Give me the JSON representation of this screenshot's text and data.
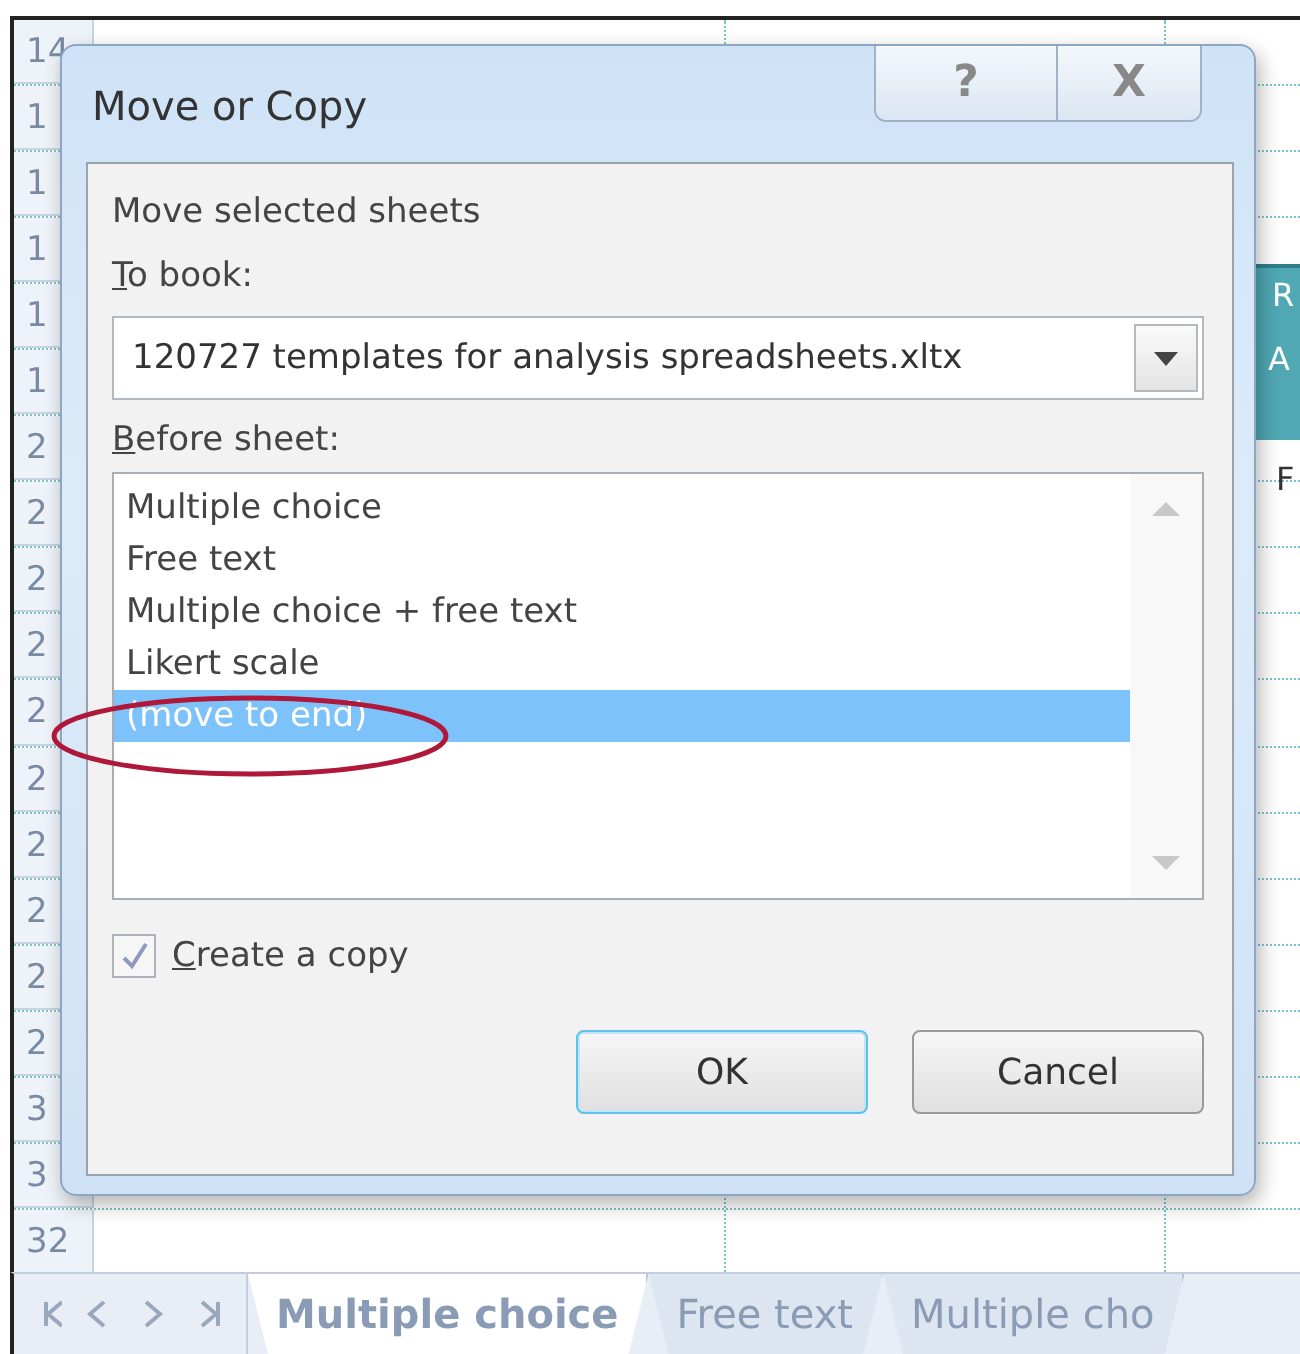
{
  "sheet": {
    "rows": [
      {
        "number": "14"
      },
      {
        "number": "1"
      },
      {
        "number": "1"
      },
      {
        "number": "1"
      },
      {
        "number": "1"
      },
      {
        "number": "1"
      },
      {
        "number": "2"
      },
      {
        "number": "2"
      },
      {
        "number": "2"
      },
      {
        "number": "2"
      },
      {
        "number": "2"
      },
      {
        "number": "2"
      },
      {
        "number": "2"
      },
      {
        "number": "2"
      },
      {
        "number": "2"
      },
      {
        "number": "2"
      },
      {
        "number": "3"
      },
      {
        "number": "3"
      },
      {
        "number": "32"
      }
    ],
    "cell_fragments": [
      {
        "text": "R",
        "kind": "header"
      },
      {
        "text": "A",
        "kind": "header"
      },
      {
        "text": "F",
        "kind": "plain"
      }
    ]
  },
  "dialog": {
    "title": "Move or Copy",
    "help_button": "?",
    "close_button": "X",
    "heading": "Move selected sheets",
    "to_book": {
      "label": "To book:",
      "access_key_underlined": true,
      "value": "120727 templates for analysis spreadsheets.xltx"
    },
    "before_sheet": {
      "label": "Before sheet:",
      "access_key_underlined": true,
      "items": [
        {
          "label": "Multiple choice",
          "selected": false
        },
        {
          "label": "Free text",
          "selected": false
        },
        {
          "label": "Multiple choice + free text",
          "selected": false
        },
        {
          "label": "Likert scale",
          "selected": false
        },
        {
          "label": "(move to end)",
          "selected": true
        }
      ]
    },
    "create_copy": {
      "label": "Create a copy",
      "access_key_underlined": true,
      "checked": true
    },
    "buttons": [
      {
        "label": "OK",
        "default": true
      },
      {
        "label": "Cancel",
        "default": false
      }
    ]
  },
  "sheet_tabs": [
    {
      "label": "Multiple choice",
      "selected": true
    },
    {
      "label": "Free text",
      "selected": false
    },
    {
      "label": "Multiple cho",
      "selected": false
    }
  ]
}
